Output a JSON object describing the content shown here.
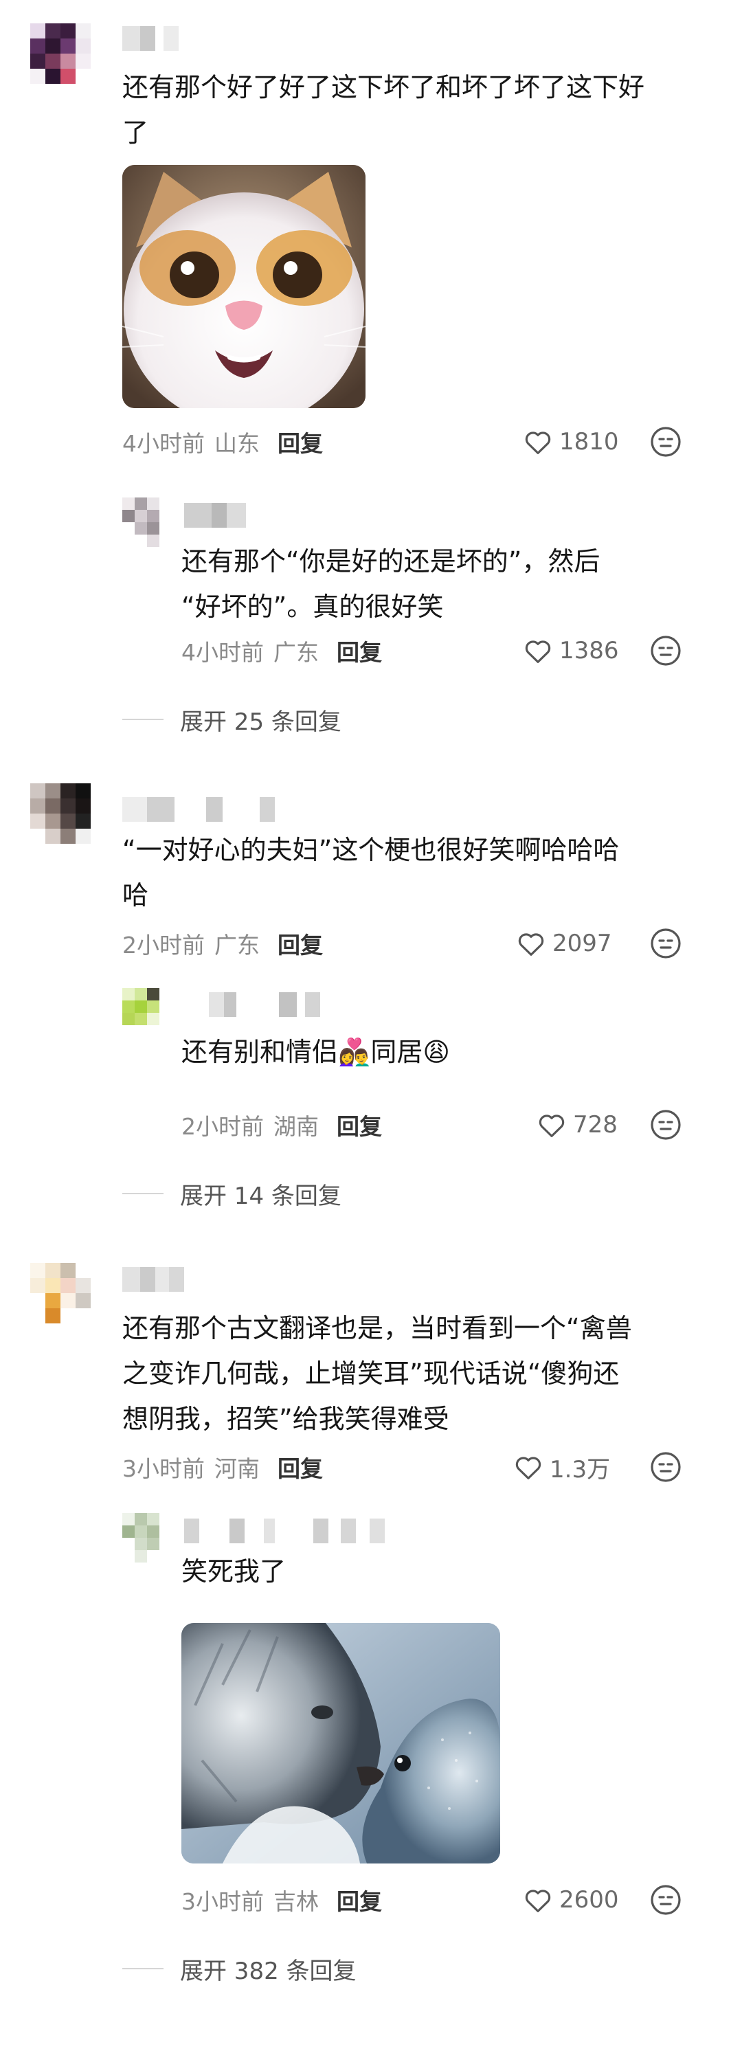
{
  "threads": [
    {
      "comment": {
        "text_lines": [
          "还有那个好了好了这下坏了和坏了坏了这下好",
          "了"
        ],
        "time": "4小时前",
        "location": "山东",
        "reply_label": "回复",
        "likes": "1810"
      },
      "replies": [
        {
          "text_lines": [
            "还有那个“你是好的还是坏的”，然后",
            "“好坏的”。真的很好笑"
          ],
          "time": "4小时前",
          "location": "广东",
          "reply_label": "回复",
          "likes": "1386"
        }
      ],
      "expand_label": "展开 25 条回复"
    },
    {
      "comment": {
        "text_lines": [
          "“一对好心的夫妇”这个梗也很好笑啊哈哈哈",
          "哈"
        ],
        "time": "2小时前",
        "location": "广东",
        "reply_label": "回复",
        "likes": "2097"
      },
      "replies": [
        {
          "text_lines": [
            "还有别和情侣👩‍❤️‍👨同居😩"
          ],
          "time": "2小时前",
          "location": "湖南",
          "reply_label": "回复",
          "likes": "728"
        }
      ],
      "expand_label": "展开 14 条回复"
    },
    {
      "comment": {
        "text_lines": [
          "还有那个古文翻译也是，当时看到一个“禽兽",
          "之变诈几何哉，止增笑耳”现代话说“傻狗还",
          "想阴我，招笑”给我笑得难受"
        ],
        "time": "3小时前",
        "location": "河南",
        "reply_label": "回复",
        "likes": "1.3万"
      },
      "replies": [
        {
          "text_lines": [
            "笑死我了"
          ],
          "time": "3小时前",
          "location": "吉林",
          "reply_label": "回复",
          "likes": "2600"
        }
      ],
      "expand_label": "展开 382 条回复"
    }
  ],
  "colors": {
    "text": "#161616",
    "meta": "#8a8a8a",
    "heart_stroke": "#555555"
  }
}
